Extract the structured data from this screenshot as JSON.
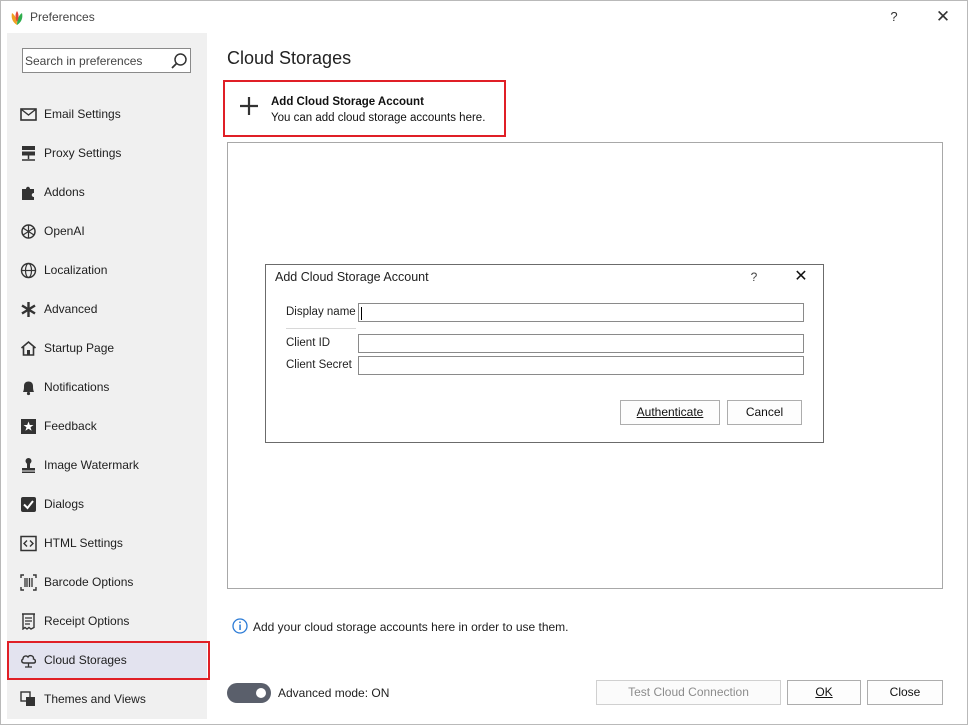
{
  "window": {
    "title": "Preferences",
    "help_glyph": "?",
    "close_glyph": "✕"
  },
  "sidebar": {
    "search_placeholder": "Search in preferences",
    "items": [
      {
        "label": "Email Settings",
        "icon": "envelope-icon"
      },
      {
        "label": "Proxy Settings",
        "icon": "server-icon"
      },
      {
        "label": "Addons",
        "icon": "puzzle-icon"
      },
      {
        "label": "OpenAI",
        "icon": "openai-icon"
      },
      {
        "label": "Localization",
        "icon": "globe-icon"
      },
      {
        "label": "Advanced",
        "icon": "asterisk-icon"
      },
      {
        "label": "Startup Page",
        "icon": "house-icon"
      },
      {
        "label": "Notifications",
        "icon": "bell-icon"
      },
      {
        "label": "Feedback",
        "icon": "star-icon"
      },
      {
        "label": "Image Watermark",
        "icon": "stamp-icon"
      },
      {
        "label": "Dialogs",
        "icon": "checkbox-icon"
      },
      {
        "label": "HTML Settings",
        "icon": "code-icon"
      },
      {
        "label": "Barcode Options",
        "icon": "barcode-icon"
      },
      {
        "label": "Receipt Options",
        "icon": "receipt-icon"
      },
      {
        "label": "Cloud Storages",
        "icon": "cloud-icon",
        "selected": true
      },
      {
        "label": "Themes and Views",
        "icon": "palette-icon"
      }
    ],
    "advanced_mode_label": "Advanced mode: ON",
    "advanced_mode_on": true
  },
  "main": {
    "title": "Cloud Storages",
    "add_account": {
      "title": "Add Cloud Storage Account",
      "subtitle": "You can add cloud storage accounts here."
    },
    "info_text": "Add your cloud storage accounts here in order to use them."
  },
  "dialog": {
    "title": "Add Cloud Storage Account",
    "help_glyph": "?",
    "close_glyph": "✕",
    "fields": [
      {
        "label": "Display name",
        "value": ""
      },
      {
        "label": "Client ID",
        "value": ""
      },
      {
        "label": "Client Secret",
        "value": ""
      }
    ],
    "authenticate_label": "Authenticate",
    "cancel_label": "Cancel"
  },
  "footer": {
    "test_connection_label": "Test Cloud Connection",
    "ok_label": "OK",
    "close_label": "Close"
  },
  "colors": {
    "highlight_red": "#e01f26",
    "sidebar_bg": "#f0f0f0",
    "toggle_bg": "#5a5f6b",
    "info_blue": "#2b7bd6"
  }
}
